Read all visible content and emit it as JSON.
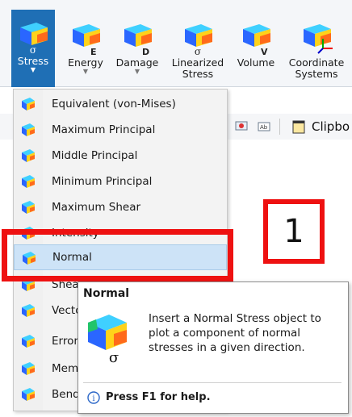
{
  "ribbon": {
    "buttons": [
      {
        "label": "Stress",
        "glyph": "σ",
        "has_dropdown": true,
        "active": true
      },
      {
        "label": "Energy",
        "glyph": "E",
        "has_dropdown": true
      },
      {
        "label": "Damage",
        "glyph": "D",
        "has_dropdown": true
      },
      {
        "label": "Linearized\nStress",
        "glyph": "σ",
        "has_dropdown": true
      },
      {
        "label": "Volume",
        "glyph": "V",
        "has_dropdown": false
      },
      {
        "label": "Coordinate\nSystems",
        "glyph": "",
        "has_dropdown": true
      }
    ]
  },
  "toolbar": {
    "clipboard_label": "Clipbo"
  },
  "menu": {
    "items": [
      {
        "label": "Equivalent (von-Mises)"
      },
      {
        "label": "Maximum Principal"
      },
      {
        "label": "Middle Principal"
      },
      {
        "label": "Minimum Principal"
      },
      {
        "label": "Maximum Shear"
      },
      {
        "label": "Intensity"
      },
      {
        "label": "Normal",
        "highlighted": true
      },
      {
        "label": "Shear"
      },
      {
        "label": "Vecto"
      },
      {
        "label": "Error"
      },
      {
        "label": "Mem"
      },
      {
        "label": "Bend"
      }
    ]
  },
  "tooltip": {
    "title": "Normal",
    "body": "Insert a Normal Stress object to plot a component of normal stresses in a given direction.",
    "help": "Press F1 for help."
  },
  "annotation": {
    "number": "1",
    "color": "#ee1111"
  },
  "colors": {
    "accent": "#1f6fb5",
    "highlight": "#cde3f7"
  }
}
